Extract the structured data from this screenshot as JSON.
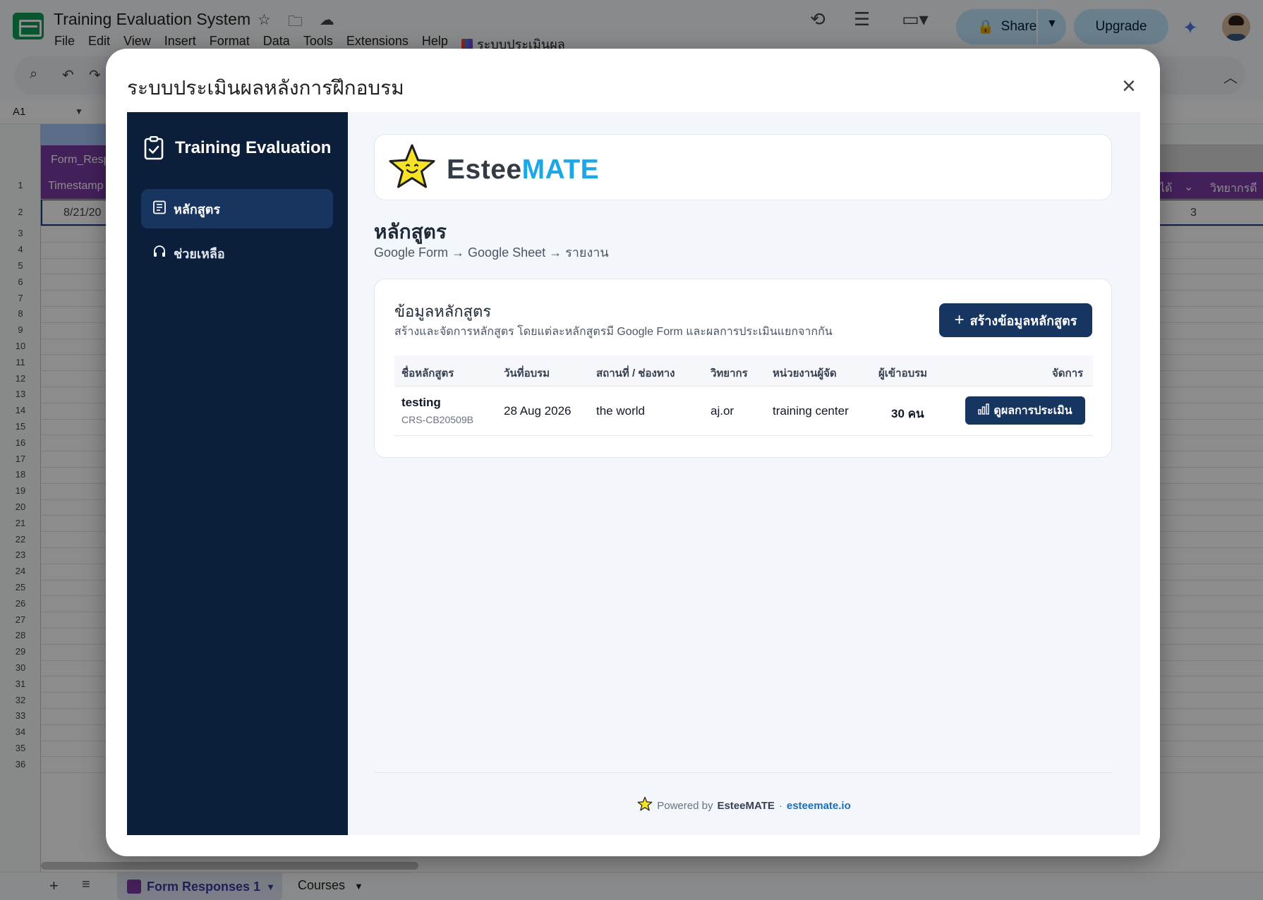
{
  "sheets": {
    "doc_title": "Training Evaluation System",
    "menu": [
      "File",
      "Edit",
      "View",
      "Insert",
      "Format",
      "Data",
      "Tools",
      "Extensions",
      "Help"
    ],
    "apps_menu": "ระบบประเมินผล",
    "share_label": "Share",
    "upgrade_label": "Upgrade",
    "cell_ref": "A1",
    "band_label": "Form_Resp",
    "header_cell": "Timestamp",
    "header_right_1": "ได้",
    "header_right_2": "วิทยากรดี",
    "row2_value": "8/21/20",
    "row2_right": "3",
    "row_numbers": [
      "1",
      "2",
      "3",
      "4",
      "5",
      "6",
      "7",
      "8",
      "9",
      "10",
      "11",
      "12",
      "13",
      "14",
      "15",
      "16",
      "17",
      "18",
      "19",
      "20",
      "21",
      "22",
      "23",
      "24",
      "25",
      "26",
      "27",
      "28",
      "29",
      "30",
      "31",
      "32",
      "33",
      "34",
      "35",
      "36"
    ],
    "tabs": {
      "active": "Form Responses 1",
      "other": "Courses"
    }
  },
  "dialog": {
    "title": "ระบบประเมินผลหลังการฝึกอบรม",
    "close_icon": "×"
  },
  "sidebar": {
    "brand": "Training Evaluation",
    "items": [
      {
        "label": "หลักสูตร",
        "active": true
      },
      {
        "label": "ช่วยเหลือ",
        "active": false
      }
    ]
  },
  "logo": {
    "part1": "Estee",
    "part2": "MATE"
  },
  "page": {
    "heading": "หลักสูตร",
    "subheading": "Google Form → Google Sheet → รายงาน"
  },
  "courses": {
    "title": "ข้อมูลหลักสูตร",
    "description": "สร้างและจัดการหลักสูตร โดยแต่ละหลักสูตรมี Google Form และผลการประเมินแยกจากกัน",
    "create_button": "สร้างข้อมูลหลักสูตร",
    "columns": [
      "ชื่อหลักสูตร",
      "วันที่อบรม",
      "สถานที่ / ช่องทาง",
      "วิทยากร",
      "หน่วยงานผู้จัด",
      "ผู้เข้าอบรม",
      "จัดการ"
    ],
    "rows": [
      {
        "name": "testing",
        "code": "CRS-CB20509B",
        "date": "28 Aug 2026",
        "venue": "the world",
        "speaker": "aj.or",
        "organizer": "training center",
        "attendees": "30 คน",
        "action": "ดูผลการประเมิน"
      }
    ]
  },
  "footer": {
    "powered": "Powered by",
    "brand": "EsteeMATE",
    "dot": "·",
    "link": "esteemate.io"
  },
  "colors": {
    "sidebar_bg": "#0b1e3a",
    "primary_button": "#163561",
    "logo_accent": "#1da7e6",
    "sheet_header_purple": "#7b3ba4"
  }
}
